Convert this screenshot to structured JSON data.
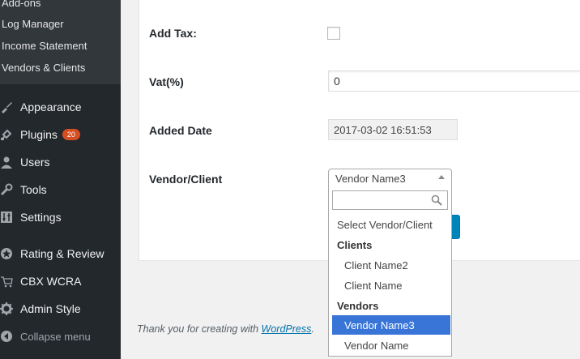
{
  "sidebar": {
    "submenu": [
      "Add-ons",
      "Log Manager",
      "Income Statement",
      "Vendors & Clients"
    ],
    "items": [
      {
        "label": "Appearance",
        "icon": "paintbrush-icon"
      },
      {
        "label": "Plugins",
        "icon": "plugin-icon",
        "badge": "20"
      },
      {
        "label": "Users",
        "icon": "users-icon"
      },
      {
        "label": "Tools",
        "icon": "wrench-icon"
      },
      {
        "label": "Settings",
        "icon": "sliders-icon"
      },
      {
        "label": "Rating & Review",
        "icon": "star-icon"
      },
      {
        "label": "CBX WCRA",
        "icon": "cart-icon"
      },
      {
        "label": "Admin Style",
        "icon": "gear-icon"
      },
      {
        "label": "Collapse menu",
        "icon": "collapse-icon"
      }
    ]
  },
  "form": {
    "add_tax_label": "Add Tax:",
    "vat_label": "Vat(%)",
    "vat_value": "0",
    "added_date_label": "Added Date",
    "added_date_value": "2017-03-02 16:51:53",
    "vendor_label": "Vendor/Client",
    "vendor_selected": "Vendor Name3"
  },
  "dropdown": {
    "search_value": "",
    "placeholder_option": "Select Vendor/Client",
    "group_clients": "Clients",
    "client_1": "Client Name2",
    "client_2": "Client Name",
    "group_vendors": "Vendors",
    "vendor_1": "Vendor Name3",
    "vendor_2": "Vendor Name"
  },
  "footer": {
    "text": "Thank you for creating with ",
    "link": "WordPress",
    "suffix": "."
  },
  "colors": {
    "sidebar_bg": "#23282d",
    "highlight": "#3875d7",
    "badge": "#d54e21",
    "button": "#0085ba"
  }
}
